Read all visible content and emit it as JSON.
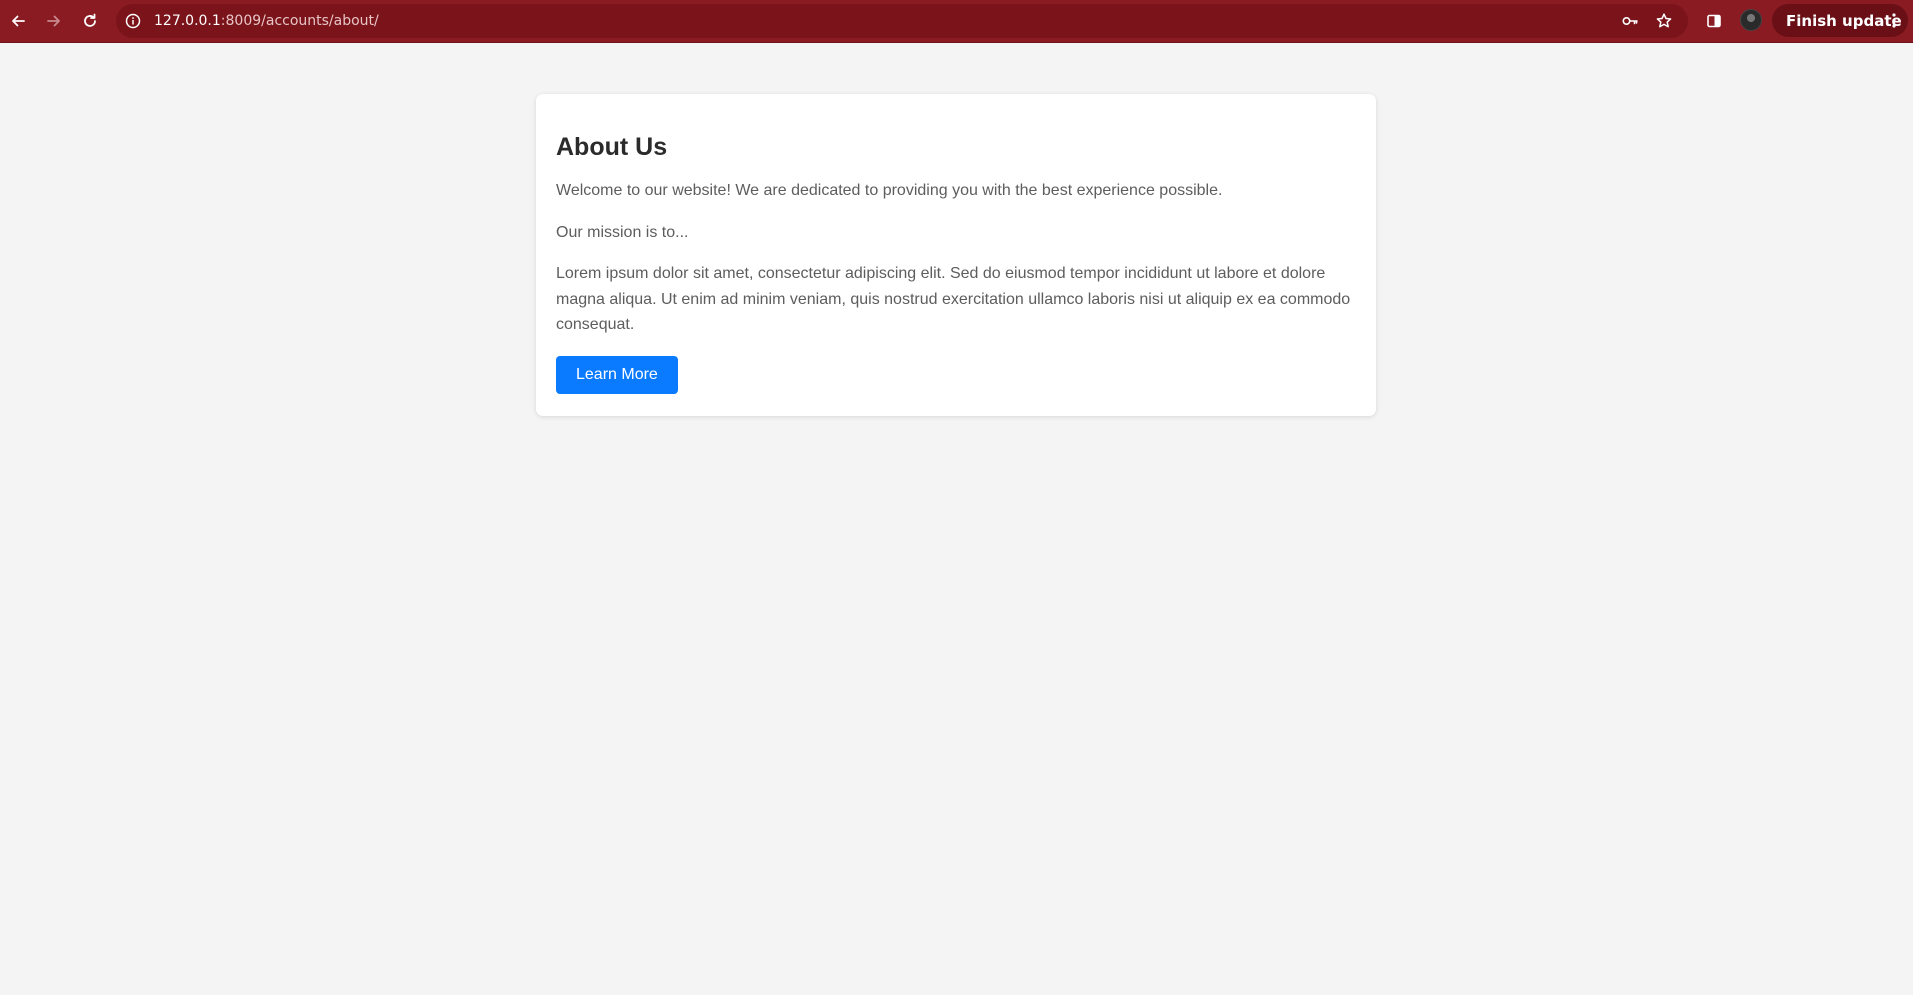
{
  "browser": {
    "url_host": "127.0.0.1",
    "url_rest": ":8009/accounts/about/",
    "finish_update_label": "Finish update",
    "icons": {
      "back": "arrow-left-icon",
      "forward": "arrow-right-icon",
      "reload": "reload-icon",
      "site_info": "info-icon",
      "password": "key-icon",
      "bookmark": "star-icon",
      "side_panel": "side-panel-icon",
      "menu": "kebab-menu-icon"
    },
    "colors": {
      "toolbar": "#8a1b22",
      "omnibox": "#7a141a",
      "finish_update": "#6a0f15"
    }
  },
  "page": {
    "title": "About Us",
    "intro": "Welcome to our website! We are dedicated to providing you with the best experience possible.",
    "mission": "Our mission is to...",
    "body": "Lorem ipsum dolor sit amet, consectetur adipiscing elit. Sed do eiusmod tempor incididunt ut labore et dolore magna aliqua. Ut enim ad minim veniam, quis nostrud exercitation ullamco laboris nisi ut aliquip ex ea commodo consequat.",
    "button_label": "Learn More",
    "colors": {
      "background": "#f4f4f4",
      "card": "#ffffff",
      "button": "#0a7bff"
    }
  }
}
